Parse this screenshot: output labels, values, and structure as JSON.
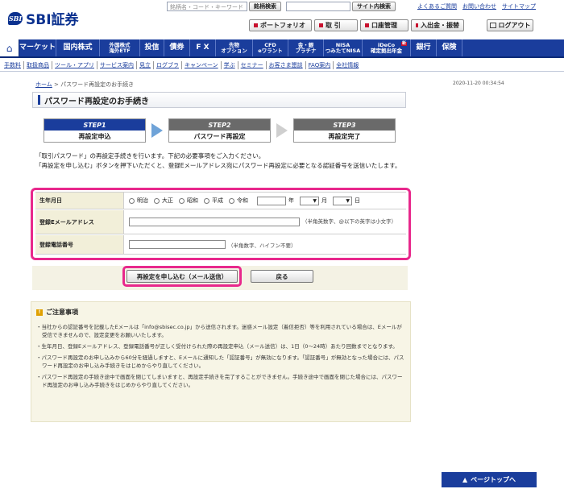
{
  "header": {
    "logo_mark": "SBI",
    "logo_text": "SBI証券",
    "search_placeholder": "銘柄名・コード・キーワード",
    "search_button": "銘柄検索",
    "site_search_button": "サイト内検索",
    "top_links": [
      "よくあるご質問",
      "お問い合わせ",
      "サイトマップ"
    ],
    "quick_buttons": [
      "ポートフォリオ",
      "取 引",
      "口座管理",
      "入出金・振替"
    ],
    "logout": "ログアウト"
  },
  "main_nav": {
    "items": [
      {
        "label": "マーケット"
      },
      {
        "label": "国内株式"
      },
      {
        "label": "外国株式\n海外ETF"
      },
      {
        "label": "投信"
      },
      {
        "label": "債券"
      },
      {
        "label": "F X"
      },
      {
        "label": "先物\nオプション"
      },
      {
        "label": "CFD\neワラント"
      },
      {
        "label": "金・銀\nプラチナ"
      },
      {
        "label": "NISA\nつみたてNISA"
      },
      {
        "label": "iDeCo\n確定拠出年金"
      },
      {
        "label": "銀行"
      },
      {
        "label": "保険"
      }
    ],
    "ideco_badge": "新"
  },
  "sub_nav": [
    "手数料",
    "取扱商品",
    "ツール・アプリ",
    "サービス案内",
    "見立",
    "ログブラ",
    "キャンペーン",
    "学ぶ",
    "セミナー",
    "お客さま懇談",
    "FAQ案内",
    "全社情報"
  ],
  "breadcrumb": {
    "home": "ホーム",
    "separator": " > ",
    "current": "パスワード再設定のお手続き"
  },
  "timestamp": "2020-11-20 00:34:54",
  "page_title": "パスワード再設定のお手続き",
  "steps": [
    {
      "head": "STEP1",
      "label": "再設定申込"
    },
    {
      "head": "STEP2",
      "label": "パスワード再設定"
    },
    {
      "head": "STEP3",
      "label": "再設定完了"
    }
  ],
  "intro": [
    "「取引パスワード」の再設定手続きを行います。下記の必要事項をご入力ください。",
    "「再設定を申し込む」ボタンを押下いただくと、登録Eメールアドレス宛にパスワード再設定に必要となる認証番号を送信いたします。"
  ],
  "form": {
    "birth_label": "生年月日",
    "eras": [
      "明治",
      "大正",
      "昭和",
      "平成",
      "令和"
    ],
    "year_suffix": "年",
    "month_suffix": "月",
    "day_suffix": "日",
    "email_label": "登録Eメールアドレス",
    "email_note": "（半角英数字、@以下の英字は小文字）",
    "phone_label": "登録電話番号",
    "phone_note": "（半角数字、ハイフン不要）"
  },
  "buttons": {
    "submit": "再設定を申し込む（メール送信）",
    "back": "戻る"
  },
  "notice": {
    "icon": "!",
    "title": "ご注意事項",
    "items": [
      "・当社からの認証番号を記載したEメールは「info@sbisec.co.jp」から送信されます。迷惑メール設定（着信拒否）等を利用されている場合は、Eメールが受信できませんので、設定変更をお願いいたします。",
      "・生年月日、登録Eメールアドレス、登録電話番号が正しく受付けられた際の再設定申込（メール送信）は、1日（0〜24時）あたり回数までとなります。",
      "・パスワード再設定のお申し込みから60分を経過しますと、Eメールに通知した「認証番号」が無効になります。「認証番号」が無効となった場合には、パスワード再設定のお申し込み手続きをはじめからやり直してください。",
      "・パスワード再設定の手続き途中で画面を閉じてしまいますと、再設定手続きを完了することができません。手続き途中で画面を閉じた場合には、パスワード再設定のお申し込み手続きをはじめからやり直してください。"
    ]
  },
  "page_top": "ページトップへ"
}
